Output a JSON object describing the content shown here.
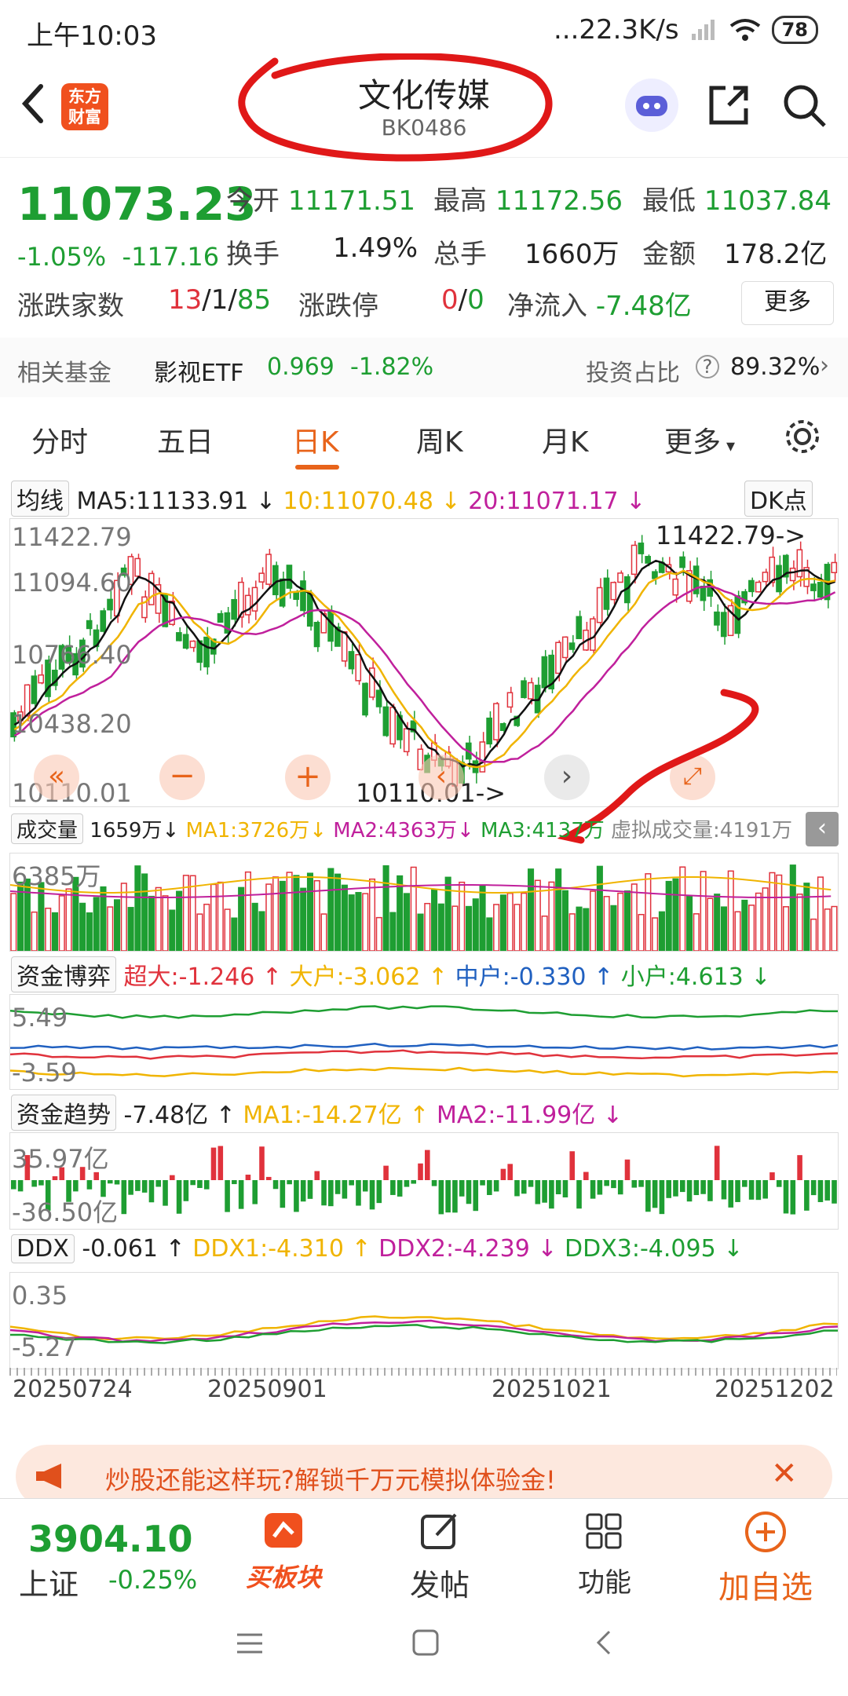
{
  "status_bar": {
    "time": "上午10:03",
    "network": "...22.3K/s",
    "battery": "78"
  },
  "header": {
    "title": "文化传媒",
    "code": "BK0486",
    "logo_line1": "东方",
    "logo_line2": "财富"
  },
  "quote": {
    "price": "11073.23",
    "change_pct": "-1.05%",
    "change_abs": "-117.16",
    "open_label": "今开",
    "open": "11171.51",
    "high_label": "最高",
    "high": "11172.56",
    "low_label": "最低",
    "low": "11037.84",
    "turnover_label": "换手",
    "turnover": "1.49%",
    "volume_label": "总手",
    "volume": "1660万",
    "amount_label": "金额",
    "amount": "178.2亿",
    "updown_label": "涨跌家数",
    "up": "13",
    "flat": "1",
    "down": "85",
    "limit_label": "涨跌停",
    "limit_up": "0",
    "limit_down": "0",
    "inflow_label": "净流入",
    "inflow": "-7.48亿",
    "more": "更多"
  },
  "fund": {
    "label": "相关基金",
    "name": "影视ETF",
    "value": "0.969",
    "pct": "-1.82%",
    "ratio_label": "投资占比",
    "ratio": "89.32%"
  },
  "tabs": [
    "分时",
    "五日",
    "日K",
    "周K",
    "月K",
    "更多"
  ],
  "ma": {
    "selector": "均线",
    "ma5": "MA5:11133.91",
    "ma10": "10:11070.48",
    "ma20": "20:11071.17",
    "dk": "DK点"
  },
  "kline": {
    "y_labels": [
      "11422.79",
      "11094.60",
      "10766.40",
      "10438.20",
      "10110.01"
    ],
    "max_marker": "11422.79->",
    "min_marker": "10110.01->"
  },
  "volume": {
    "selector": "成交量",
    "val": "1659万",
    "ma1": "MA1:3726万",
    "ma2": "MA2:4363万",
    "ma3": "MA3:4137万",
    "virtual": "虚拟成交量:4191万",
    "axis": "6385万"
  },
  "capital_game": {
    "selector": "资金博弈",
    "super": "超大:-1.246",
    "big": "大户:-3.062",
    "mid": "中户:-0.330",
    "small": "小户:4.613",
    "top": "5.49",
    "bottom": "-3.59"
  },
  "capital_trend": {
    "selector": "资金趋势",
    "val": "-7.48亿",
    "ma1": "MA1:-14.27亿",
    "ma2": "MA2:-11.99亿",
    "top": "35.97亿",
    "bottom": "-36.50亿"
  },
  "ddx": {
    "selector": "DDX",
    "val": "-0.061",
    "ddx1": "DDX1:-4.310",
    "ddx2": "DDX2:-4.239",
    "ddx3": "DDX3:-4.095",
    "top": "0.35",
    "bottom": "-5.27"
  },
  "dates": [
    "20250724",
    "20250901",
    "20251021",
    "20251202"
  ],
  "banner": {
    "text": "炒股还能这样玩?解锁千万元模拟体验金!"
  },
  "bottom_bar": {
    "index_value": "3904.10",
    "index_name": "上证",
    "index_pct": "-0.25%",
    "buy": "买板块",
    "post": "发帖",
    "func": "功能",
    "add": "加自选"
  },
  "colors": {
    "up": "#e0323c",
    "down": "#1e9e32",
    "accent": "#e8641b",
    "ma5": "#111111",
    "ma10": "#f0b400",
    "ma20": "#c0209c"
  }
}
